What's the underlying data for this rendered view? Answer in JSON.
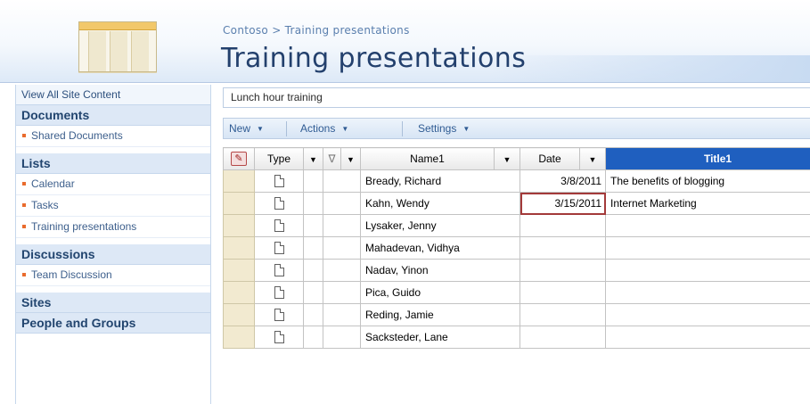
{
  "header": {
    "breadcrumb_root": "Contoso",
    "breadcrumb_sep": " > ",
    "breadcrumb_current": "Training presentations",
    "title": "Training presentations"
  },
  "quicklaunch": {
    "view_all": "View All Site Content",
    "sections": [
      {
        "heading": "Documents",
        "items": [
          "Shared Documents"
        ]
      },
      {
        "heading": "Lists",
        "items": [
          "Calendar",
          "Tasks",
          "Training presentations"
        ]
      },
      {
        "heading": "Discussions",
        "items": [
          "Team Discussion"
        ]
      },
      {
        "heading": "Sites",
        "items": []
      },
      {
        "heading": "People and Groups",
        "items": []
      }
    ]
  },
  "view": {
    "name": "Lunch hour training"
  },
  "toolbar": {
    "new_label": "New",
    "actions_label": "Actions",
    "settings_label": "Settings",
    "dropdown_icon": "triangle-down-icon"
  },
  "grid": {
    "columns": {
      "type": "Type",
      "name": "Name1",
      "date": "Date",
      "title": "Title1"
    },
    "rows": [
      {
        "name": "Bready, Richard",
        "date": "3/8/2011",
        "title": "The benefits of blogging"
      },
      {
        "name": "Kahn, Wendy",
        "date": "3/15/2011",
        "title": "Internet Marketing"
      },
      {
        "name": "Lysaker, Jenny",
        "date": "",
        "title": ""
      },
      {
        "name": "Mahadevan, Vidhya",
        "date": "",
        "title": ""
      },
      {
        "name": "Nadav, Yinon",
        "date": "",
        "title": ""
      },
      {
        "name": "Pica, Guido",
        "date": "",
        "title": ""
      },
      {
        "name": "Reding, Jamie",
        "date": "",
        "title": ""
      },
      {
        "name": "Sacksteder, Lane",
        "date": "",
        "title": ""
      }
    ]
  },
  "colors": {
    "title": "#23406d",
    "selected_column": "#1f5fbf",
    "focus_outline": "#a33a3a"
  }
}
